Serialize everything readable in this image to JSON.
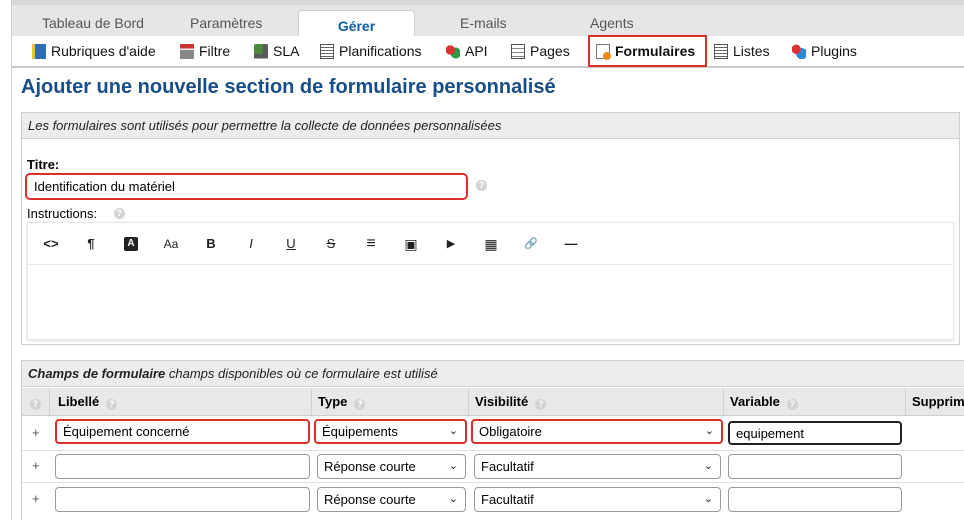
{
  "main_tabs": [
    {
      "label": "Tableau de Bord"
    },
    {
      "label": "Paramètres"
    },
    {
      "label": "Gérer"
    },
    {
      "label": "E-mails"
    },
    {
      "label": "Agents"
    }
  ],
  "sub_nav": [
    {
      "label": "Rubriques d'aide",
      "icon": "help-topics-icon"
    },
    {
      "label": "Filtre",
      "icon": "filter-icon"
    },
    {
      "label": "SLA",
      "icon": "sla-icon"
    },
    {
      "label": "Planifications",
      "icon": "schedule-icon"
    },
    {
      "label": "API",
      "icon": "api-icon"
    },
    {
      "label": "Pages",
      "icon": "pages-icon"
    },
    {
      "label": "Formulaires",
      "icon": "forms-icon"
    },
    {
      "label": "Listes",
      "icon": "lists-icon"
    },
    {
      "label": "Plugins",
      "icon": "plugins-icon"
    }
  ],
  "page_title": "Ajouter une nouvelle section de formulaire personnalisé",
  "form_section": {
    "header": "Les formulaires sont utilisés pour permettre la collecte de données personnalisées",
    "title_label": "Titre:",
    "title_value": "Identification du matériel",
    "instructions_label": "Instructions:"
  },
  "editor_toolbar": [
    "<>",
    "¶",
    "A",
    "Aa",
    "B",
    "I",
    "U",
    "S",
    "≡",
    "▣",
    "▶",
    "▦",
    "🔗",
    "—"
  ],
  "fields_section": {
    "header_bold": "Champs de formulaire",
    "header_rest": " champs disponibles où ce formulaire est utilisé",
    "columns": [
      "Libellé",
      "Type",
      "Visibilité",
      "Variable",
      "Supprimer"
    ],
    "plus": "+",
    "rows": [
      {
        "label": "Équipement concerné",
        "type": "Équipements",
        "visibility": "Obligatoire",
        "variable": "equipement"
      },
      {
        "label": "",
        "type": "Réponse courte",
        "visibility": "Facultatif",
        "variable": ""
      },
      {
        "label": "",
        "type": "Réponse courte",
        "visibility": "Facultatif",
        "variable": ""
      }
    ]
  },
  "colors": {
    "accent": "#184e87",
    "highlight": "#d9302c",
    "active_tab": "#0a5ea8"
  }
}
